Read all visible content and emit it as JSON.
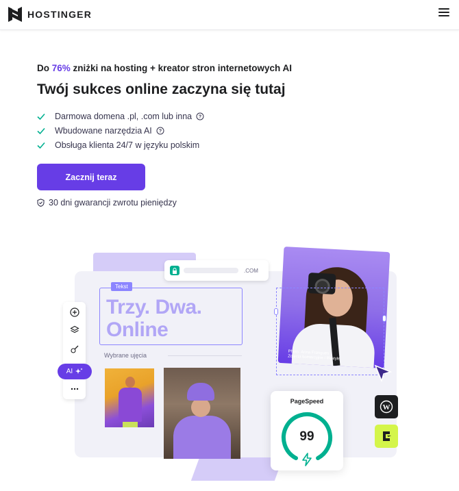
{
  "header": {
    "brand": "HOSTINGER",
    "logo_icon": "hostinger-logo-icon",
    "menu_icon": "hamburger-menu-icon"
  },
  "hero": {
    "promo_prefix": "Do ",
    "promo_accent": "76%",
    "promo_suffix": " zniżki na hosting + kreator stron internetowych AI",
    "title": "Twój sukces online zaczyna się tutaj",
    "features": [
      {
        "label": "Darmowa domena .pl, .com lub inna",
        "has_help": true
      },
      {
        "label": "Wbudowane narzędzia AI",
        "has_help": true
      },
      {
        "label": "Obsługa klienta 24/7 w języku polskim",
        "has_help": false
      }
    ],
    "cta_label": "Zacznij teraz",
    "guarantee": "30 dni gwarancji zwrotu pieniędzy"
  },
  "illustration": {
    "url_text": ".COM",
    "text_tag": "Tekst",
    "big_text_line1": "Trzy. Dwa.",
    "big_text_line2": "Online",
    "selected_label": "Wybrane ujęcia",
    "ai_label": "AI",
    "photo_credit_line1": "Photo: Anna Frangues",
    "photo_credit_line2": "Zdjęcia komercyjne i lifestyle",
    "pagespeed_title": "PageSpeed",
    "pagespeed_score": "99"
  },
  "colors": {
    "accent": "#673de6",
    "check": "#00b090",
    "lavender": "#d5ccf8",
    "lime": "#d4f54a"
  }
}
